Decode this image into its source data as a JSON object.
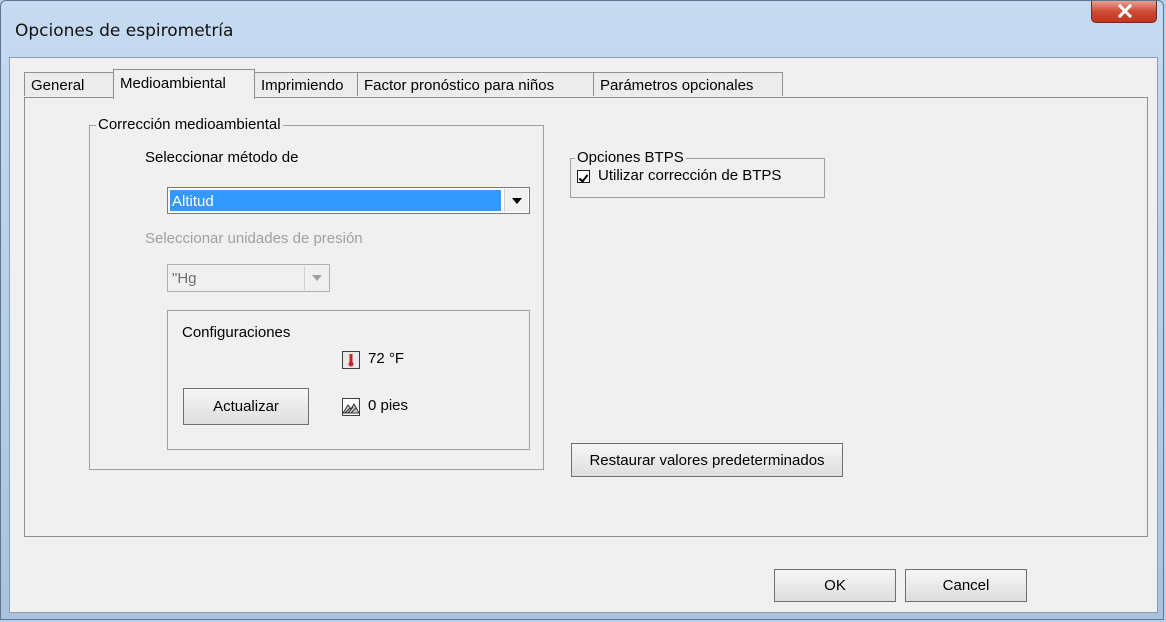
{
  "window": {
    "title": "Opciones de espirometría"
  },
  "tabs": [
    {
      "label": "General"
    },
    {
      "label": "Medioambiental"
    },
    {
      "label": "Imprimiendo"
    },
    {
      "label": "Factor pronóstico para niños"
    },
    {
      "label": "Parámetros opcionales"
    }
  ],
  "active_tab": "Medioambiental",
  "environmental": {
    "group_label": "Corrección medioambiental",
    "method_label": "Seleccionar método de",
    "method_value": "Altitud",
    "pressure_label": "Seleccionar unidades de presión",
    "pressure_value": "\"Hg",
    "settings": {
      "group_label": "Configuraciones",
      "temperature": "72 °F",
      "altitude": "0 pies",
      "update_button": "Actualizar"
    }
  },
  "btps": {
    "group_label": "Opciones BTPS",
    "checkbox_label": "Utilizar corrección de BTPS",
    "checked": true
  },
  "restore_button": "Restaurar valores predeterminados",
  "footer": {
    "ok_label": "OK",
    "cancel_label": "Cancel"
  },
  "icons": {
    "close": "close-icon",
    "thermometer": "thermometer-icon",
    "altitude": "mountain-icon",
    "dropdown": "chevron-down-icon"
  },
  "colors": {
    "selection": "#3399ff",
    "close_button": "#c9442c",
    "title_bar": "#b9d1ea"
  }
}
